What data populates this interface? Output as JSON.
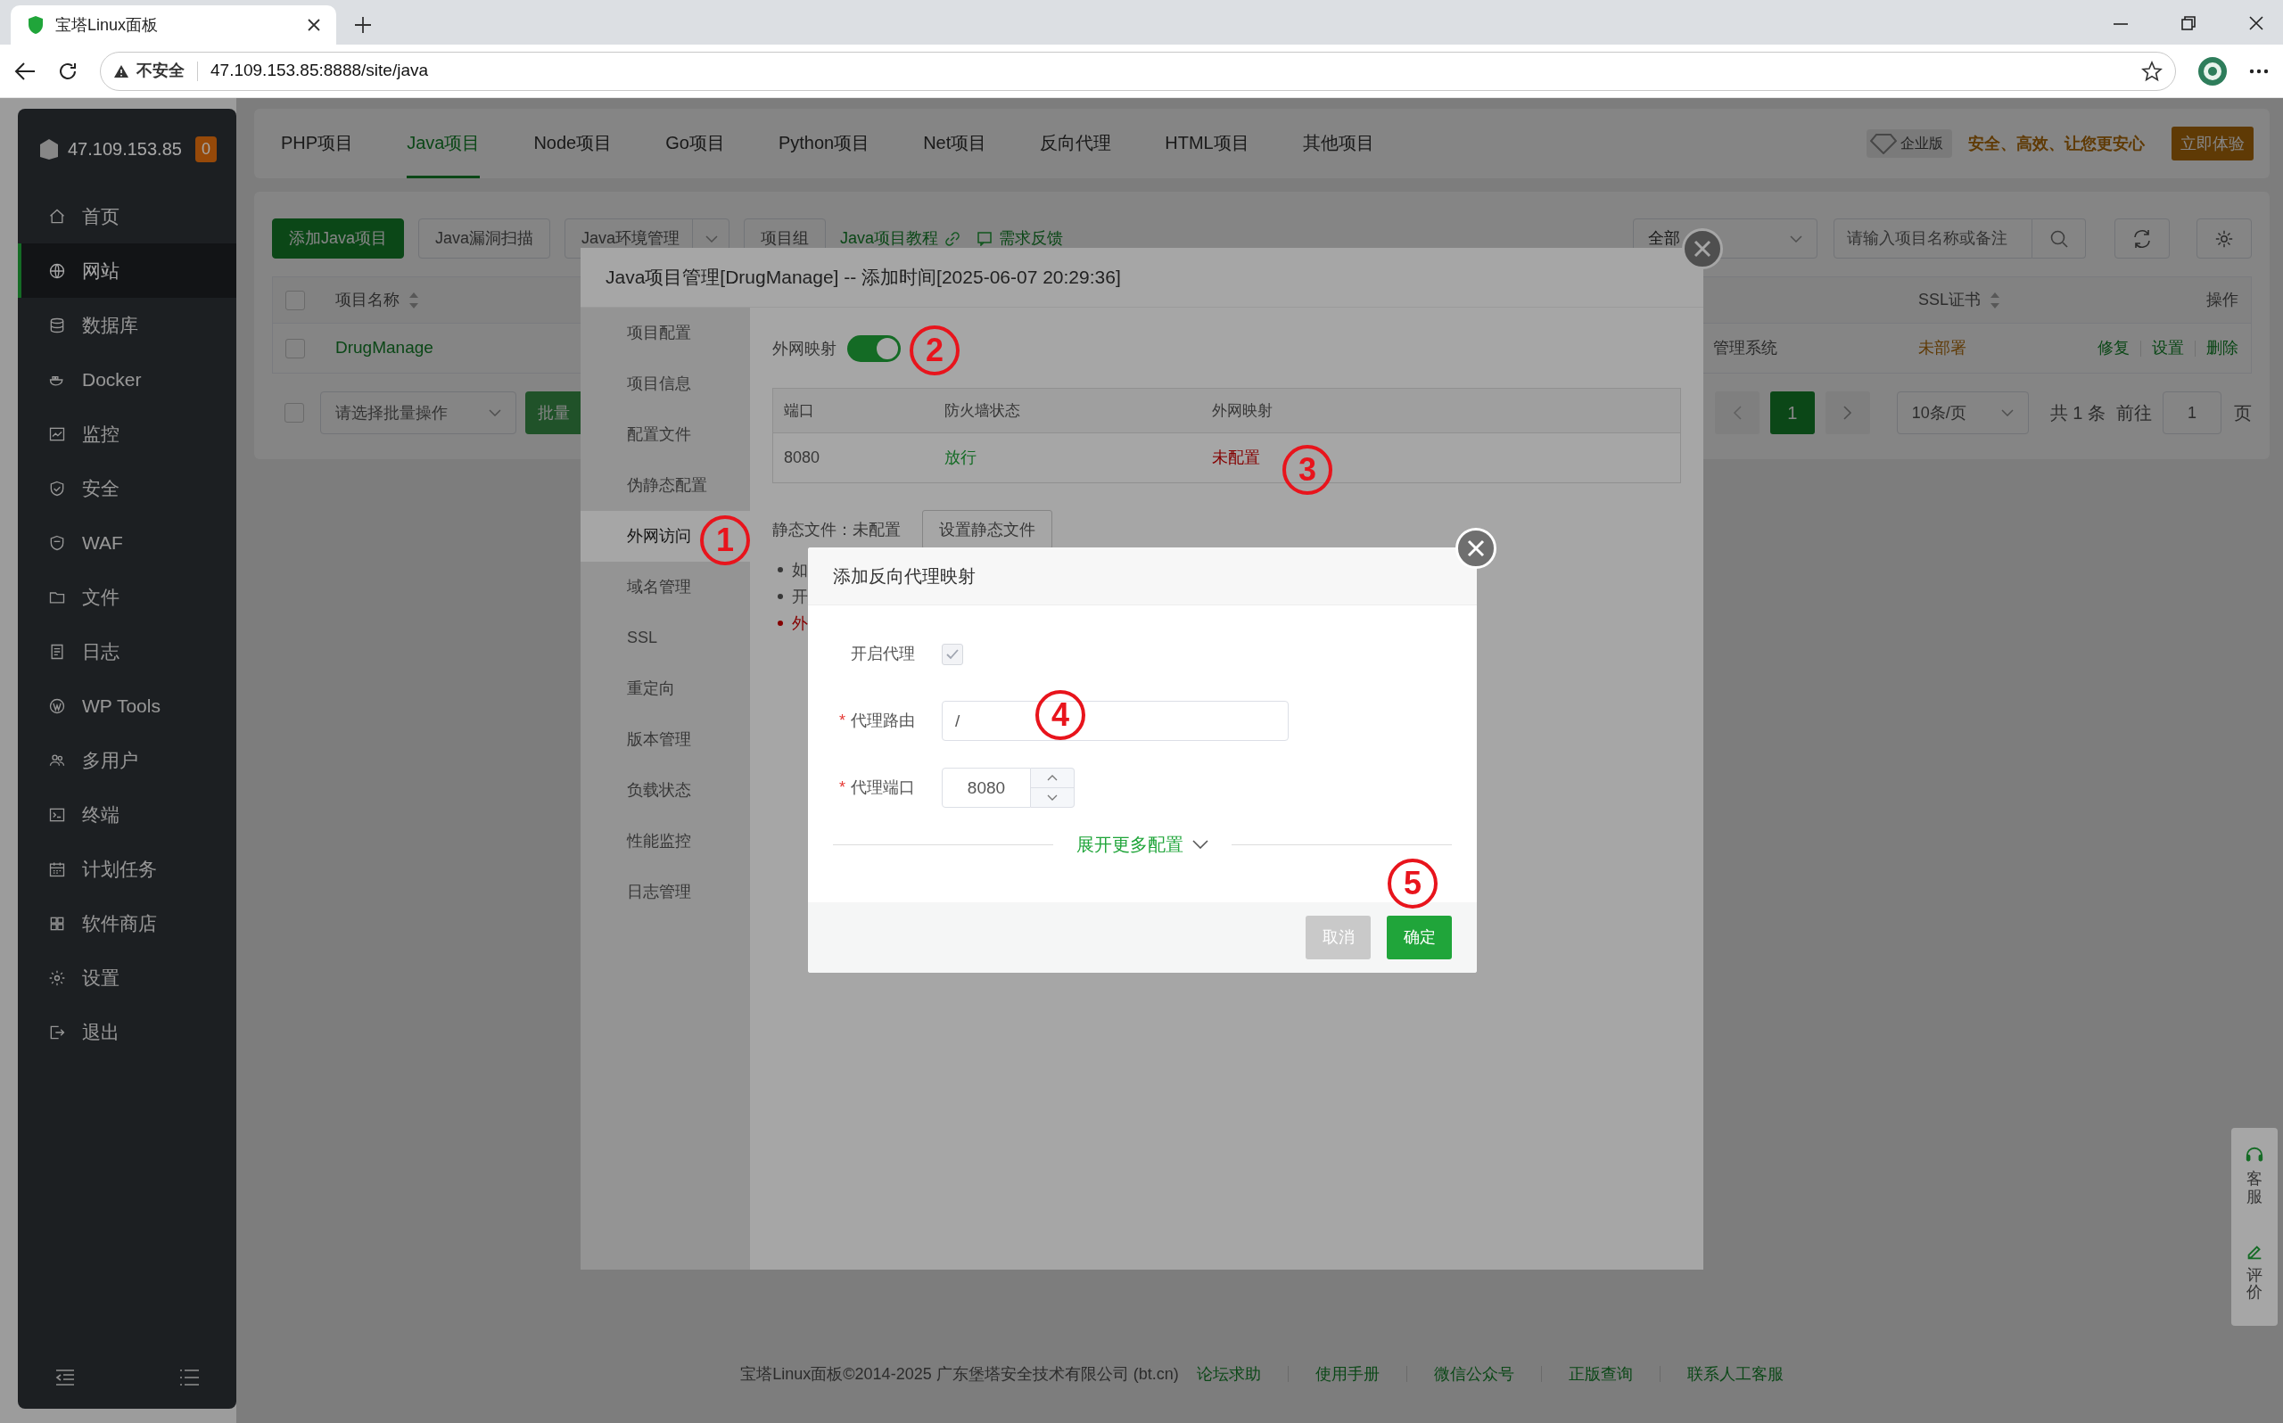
{
  "browser": {
    "tab_title": "宝塔Linux面板",
    "security": "不安全",
    "url": "47.109.153.85:8888/site/java"
  },
  "sidebar": {
    "host": "47.109.153.85",
    "badge": "0",
    "items": [
      {
        "label": "首页",
        "selected": false
      },
      {
        "label": "网站",
        "selected": true
      },
      {
        "label": "数据库",
        "selected": false
      },
      {
        "label": "Docker",
        "selected": false
      },
      {
        "label": "监控",
        "selected": false
      },
      {
        "label": "安全",
        "selected": false
      },
      {
        "label": "WAF",
        "selected": false
      },
      {
        "label": "文件",
        "selected": false
      },
      {
        "label": "日志",
        "selected": false
      },
      {
        "label": "WP Tools",
        "selected": false
      },
      {
        "label": "多用户",
        "selected": false
      },
      {
        "label": "终端",
        "selected": false
      },
      {
        "label": "计划任务",
        "selected": false
      },
      {
        "label": "软件商店",
        "selected": false
      },
      {
        "label": "设置",
        "selected": false
      },
      {
        "label": "退出",
        "selected": false
      }
    ]
  },
  "top_nav": {
    "tabs": [
      {
        "label": "PHP项目",
        "selected": false
      },
      {
        "label": "Java项目",
        "selected": true
      },
      {
        "label": "Node项目",
        "selected": false
      },
      {
        "label": "Go项目",
        "selected": false
      },
      {
        "label": "Python项目",
        "selected": false
      },
      {
        "label": "Net项目",
        "selected": false
      },
      {
        "label": "反向代理",
        "selected": false
      },
      {
        "label": "HTML项目",
        "selected": false
      },
      {
        "label": "其他项目",
        "selected": false
      }
    ],
    "edition_badge": "企业版",
    "slogan": "安全、高效、让您更安心",
    "trial_button": "立即体验"
  },
  "toolbar": {
    "buttons": [
      {
        "label": "添加Java项目",
        "kind": "primary"
      },
      {
        "label": "Java漏洞扫描",
        "kind": "default"
      },
      {
        "label": "Java环境管理",
        "kind": "dropdown"
      },
      {
        "label": "项目组",
        "kind": "default"
      }
    ],
    "links": [
      {
        "label": "Java项目教程",
        "kind": "external"
      },
      {
        "label": "需求反馈",
        "kind": "feedback"
      }
    ],
    "filter": "全部",
    "search_placeholder": "请输入项目名称或备注"
  },
  "table": {
    "all_checked": false,
    "columns": [
      "项目名称",
      "SSL证书",
      "操作"
    ],
    "rows": [
      {
        "checked": false,
        "name": "DrugManage",
        "remark": "管理系统",
        "ssl": "未部署",
        "actions": [
          "修复",
          "设置",
          "删除"
        ]
      }
    ]
  },
  "batch": {
    "checked": false,
    "placeholder": "请选择批量操作",
    "button": "批量"
  },
  "pagination": {
    "pages": [
      {
        "label": "1",
        "selected": true
      }
    ],
    "page_size": "10条/页",
    "total": "共 1 条",
    "goto_label": "前往",
    "goto_value": "1",
    "page_suffix": "页"
  },
  "footer": {
    "copyright": "宝塔Linux面板©2014-2025 广东堡塔安全技术有限公司 (bt.cn)",
    "links": [
      "论坛求助",
      "使用手册",
      "微信公众号",
      "正版查询",
      "联系人工客服"
    ]
  },
  "float_widget": [
    "客服",
    "评价"
  ],
  "modal": {
    "title": "Java项目管理[DrugManage] -- 添加时间[2025-06-07 20:29:36]",
    "menu": [
      {
        "label": "项目配置",
        "selected": false
      },
      {
        "label": "项目信息",
        "selected": false
      },
      {
        "label": "配置文件",
        "selected": false
      },
      {
        "label": "伪静态配置",
        "selected": false
      },
      {
        "label": "外网访问",
        "selected": true
      },
      {
        "label": "域名管理",
        "selected": false
      },
      {
        "label": "SSL",
        "selected": false
      },
      {
        "label": "重定向",
        "selected": false
      },
      {
        "label": "版本管理",
        "selected": false
      },
      {
        "label": "负载状态",
        "selected": false
      },
      {
        "label": "性能监控",
        "selected": false
      },
      {
        "label": "日志管理",
        "selected": false
      }
    ],
    "mapping": {
      "label": "外网映射",
      "on": true
    },
    "ports_table": {
      "columns": [
        "端口",
        "防火墙状态",
        "外网映射"
      ],
      "rows": [
        {
          "port": "8080",
          "firewall": "放行",
          "mapping": "未配置"
        }
      ]
    },
    "static_files": {
      "label": "静态文件：未配置",
      "button": "设置静态文件"
    },
    "notes": [
      {
        "text": "如",
        "kind": "normal"
      },
      {
        "text": "开",
        "kind": "normal"
      },
      {
        "text": "外",
        "kind": "warning"
      }
    ]
  },
  "dialog": {
    "title": "添加反向代理映射",
    "fields": [
      {
        "label": "开启代理",
        "kind": "checkbox",
        "checked": true
      },
      {
        "label": "代理路由",
        "kind": "text",
        "mark": "*",
        "value": "/"
      },
      {
        "label": "代理端口",
        "kind": "number",
        "mark": "*",
        "value": "8080"
      }
    ],
    "more_link": "展开更多配置",
    "buttons": [
      {
        "label": "取消",
        "kind": "cancel"
      },
      {
        "label": "确定",
        "kind": "confirm"
      }
    ]
  },
  "annotations": [
    {
      "label": "1"
    },
    {
      "label": "2"
    },
    {
      "label": "3"
    },
    {
      "label": "4"
    },
    {
      "label": "5"
    }
  ]
}
